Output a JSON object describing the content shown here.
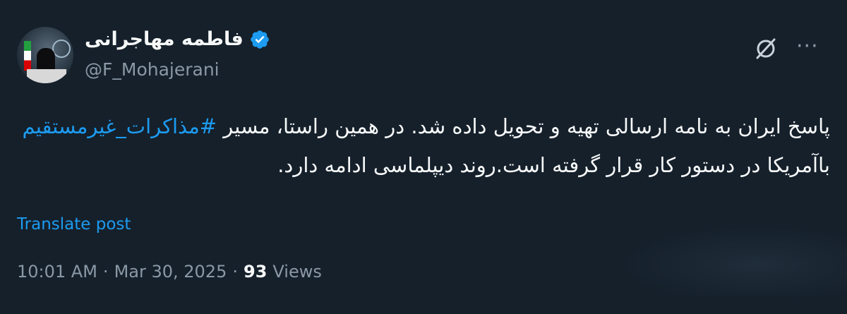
{
  "author": {
    "display_name": "فاطمه مهاجرانی",
    "handle": "@F_Mohajerani",
    "verified": true
  },
  "tweet": {
    "text_before": "پاسخ ایران به نامه ارسالی تهیه و تحویل داده شد. در همین راستا، مسیر ",
    "hashtag": "#مذاکرات_غیرمستقیم",
    "text_after": " باآمریکا در دستور کار قرار گرفته است.روند دیپلماسی ادامه دارد."
  },
  "translate_label": "Translate post",
  "meta": {
    "time": "10:01 AM",
    "sep1": "·",
    "date": "Mar 30, 2025",
    "sep2": "·",
    "views_count": "93",
    "views_label": "Views"
  },
  "icons": {
    "verified": "verified-badge-icon",
    "grok": "grok-icon",
    "more": "more-icon"
  },
  "colors": {
    "background": "#15202b",
    "accent": "#1d9bf0",
    "secondary_text": "#8b98a5"
  }
}
